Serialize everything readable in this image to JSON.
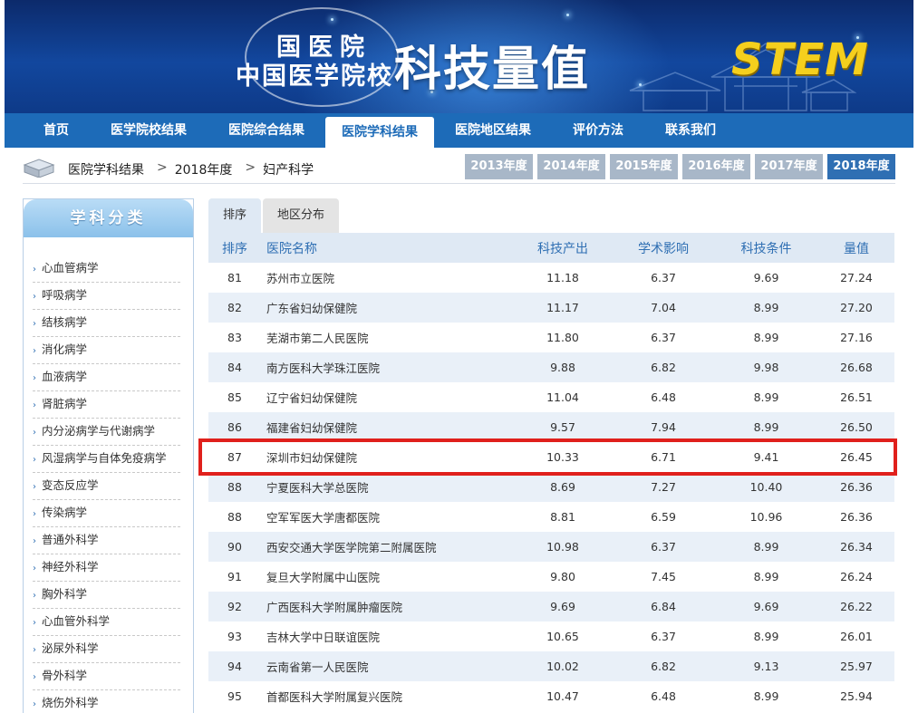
{
  "banner": {
    "brand_line1": "国医院",
    "brand_line2": "中国医学院校",
    "title": "科技量值",
    "logo_text": "STEM"
  },
  "nav": {
    "items": [
      {
        "label": "首页",
        "active": false
      },
      {
        "label": "医学院校结果",
        "active": false
      },
      {
        "label": "医院综合结果",
        "active": false
      },
      {
        "label": "医院学科结果",
        "active": true
      },
      {
        "label": "医院地区结果",
        "active": false
      },
      {
        "label": "评价方法",
        "active": false
      },
      {
        "label": "联系我们",
        "active": false
      }
    ]
  },
  "breadcrumb": {
    "items": [
      "医院学科结果",
      "2018年度",
      "妇产科学"
    ],
    "separator": ">"
  },
  "years": {
    "items": [
      "2013年度",
      "2014年度",
      "2015年度",
      "2016年度",
      "2017年度",
      "2018年度"
    ],
    "active": "2018年度"
  },
  "sidebar": {
    "title": "学科分类",
    "items": [
      "心血管病学",
      "呼吸病学",
      "结核病学",
      "消化病学",
      "血液病学",
      "肾脏病学",
      "内分泌病学与代谢病学",
      "风湿病学与自体免疫病学",
      "变态反应学",
      "传染病学",
      "普通外科学",
      "神经外科学",
      "胸外科学",
      "心血管外科学",
      "泌尿外科学",
      "骨外科学",
      "烧伤外科学"
    ]
  },
  "tabs": {
    "ranking": "排序",
    "region": "地区分布"
  },
  "table": {
    "headers": [
      "排序",
      "医院名称",
      "科技产出",
      "学术影响",
      "科技条件",
      "量值"
    ],
    "rows": [
      {
        "rank": "81",
        "name": "苏州市立医院",
        "output": "11.18",
        "impact": "6.37",
        "condition": "9.69",
        "value": "27.24"
      },
      {
        "rank": "82",
        "name": "广东省妇幼保健院",
        "output": "11.17",
        "impact": "7.04",
        "condition": "8.99",
        "value": "27.20"
      },
      {
        "rank": "83",
        "name": "芜湖市第二人民医院",
        "output": "11.80",
        "impact": "6.37",
        "condition": "8.99",
        "value": "27.16"
      },
      {
        "rank": "84",
        "name": "南方医科大学珠江医院",
        "output": "9.88",
        "impact": "6.82",
        "condition": "9.98",
        "value": "26.68"
      },
      {
        "rank": "85",
        "name": "辽宁省妇幼保健院",
        "output": "11.04",
        "impact": "6.48",
        "condition": "8.99",
        "value": "26.51"
      },
      {
        "rank": "86",
        "name": "福建省妇幼保健院",
        "output": "9.57",
        "impact": "7.94",
        "condition": "8.99",
        "value": "26.50"
      },
      {
        "rank": "87",
        "name": "深圳市妇幼保健院",
        "output": "10.33",
        "impact": "6.71",
        "condition": "9.41",
        "value": "26.45",
        "highlighted": true
      },
      {
        "rank": "88",
        "name": "宁夏医科大学总医院",
        "output": "8.69",
        "impact": "7.27",
        "condition": "10.40",
        "value": "26.36"
      },
      {
        "rank": "88",
        "name": "空军军医大学唐都医院",
        "output": "8.81",
        "impact": "6.59",
        "condition": "10.96",
        "value": "26.36"
      },
      {
        "rank": "90",
        "name": "西安交通大学医学院第二附属医院",
        "output": "10.98",
        "impact": "6.37",
        "condition": "8.99",
        "value": "26.34"
      },
      {
        "rank": "91",
        "name": "复旦大学附属中山医院",
        "output": "9.80",
        "impact": "7.45",
        "condition": "8.99",
        "value": "26.24"
      },
      {
        "rank": "92",
        "name": "广西医科大学附属肿瘤医院",
        "output": "9.69",
        "impact": "6.84",
        "condition": "9.69",
        "value": "26.22"
      },
      {
        "rank": "93",
        "name": "吉林大学中日联谊医院",
        "output": "10.65",
        "impact": "6.37",
        "condition": "8.99",
        "value": "26.01"
      },
      {
        "rank": "94",
        "name": "云南省第一人民医院",
        "output": "10.02",
        "impact": "6.82",
        "condition": "9.13",
        "value": "25.97"
      },
      {
        "rank": "95",
        "name": "首都医科大学附属复兴医院",
        "output": "10.47",
        "impact": "6.48",
        "condition": "8.99",
        "value": "25.94"
      }
    ]
  },
  "colors": {
    "banner_dark": "#0c2a6b",
    "nav_blue": "#1d6bb8",
    "header_text": "#2f6fb3",
    "row_alt": "#e9f0f8",
    "year_inactive": "#a8b7c8",
    "year_active": "#2f6fb3",
    "highlight": "#e0201c",
    "logo_yellow": "#f5cf1d"
  }
}
